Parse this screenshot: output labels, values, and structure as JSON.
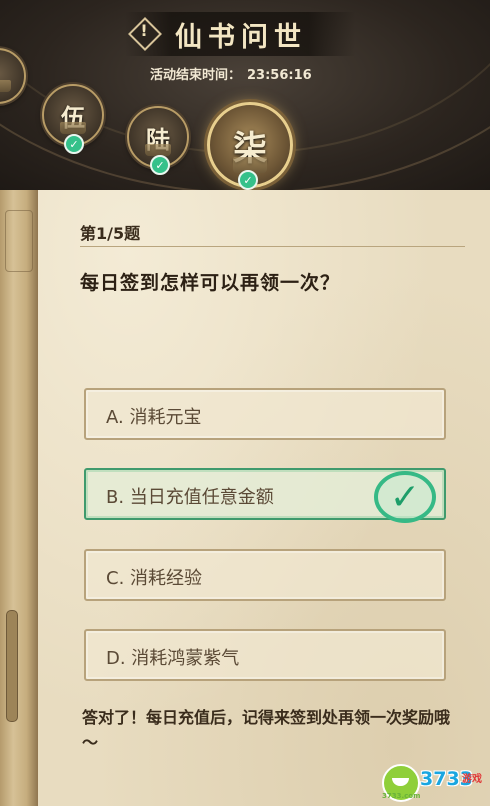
{
  "header": {
    "title": "仙书问世",
    "timer_label": "活动结束时间：",
    "timer_value": "23:56:16",
    "info_icon": "info-icon"
  },
  "levels": [
    {
      "glyph": "伍",
      "completed": true
    },
    {
      "glyph": "陆",
      "completed": true
    },
    {
      "glyph": "柒",
      "completed": true,
      "active": true
    }
  ],
  "quiz": {
    "number": "第1/5题",
    "question": "每日签到怎样可以再领一次？",
    "options": [
      {
        "label": "A. 消耗元宝",
        "correct": false
      },
      {
        "label": "B. 当日充值任意金额",
        "correct": true
      },
      {
        "label": "C. 消耗经验",
        "correct": false
      },
      {
        "label": "D. 消耗鸿蒙紫气",
        "correct": false
      }
    ],
    "feedback": "答对了！每日充值后，记得来签到处再领一次奖励哦～"
  },
  "watermark": {
    "brand": "3733",
    "suffix": "游戏",
    "tagline": "3733.com"
  },
  "colors": {
    "correct": "#36b986",
    "paper": "#e8dcc0",
    "header_bg": "#2c251f"
  }
}
